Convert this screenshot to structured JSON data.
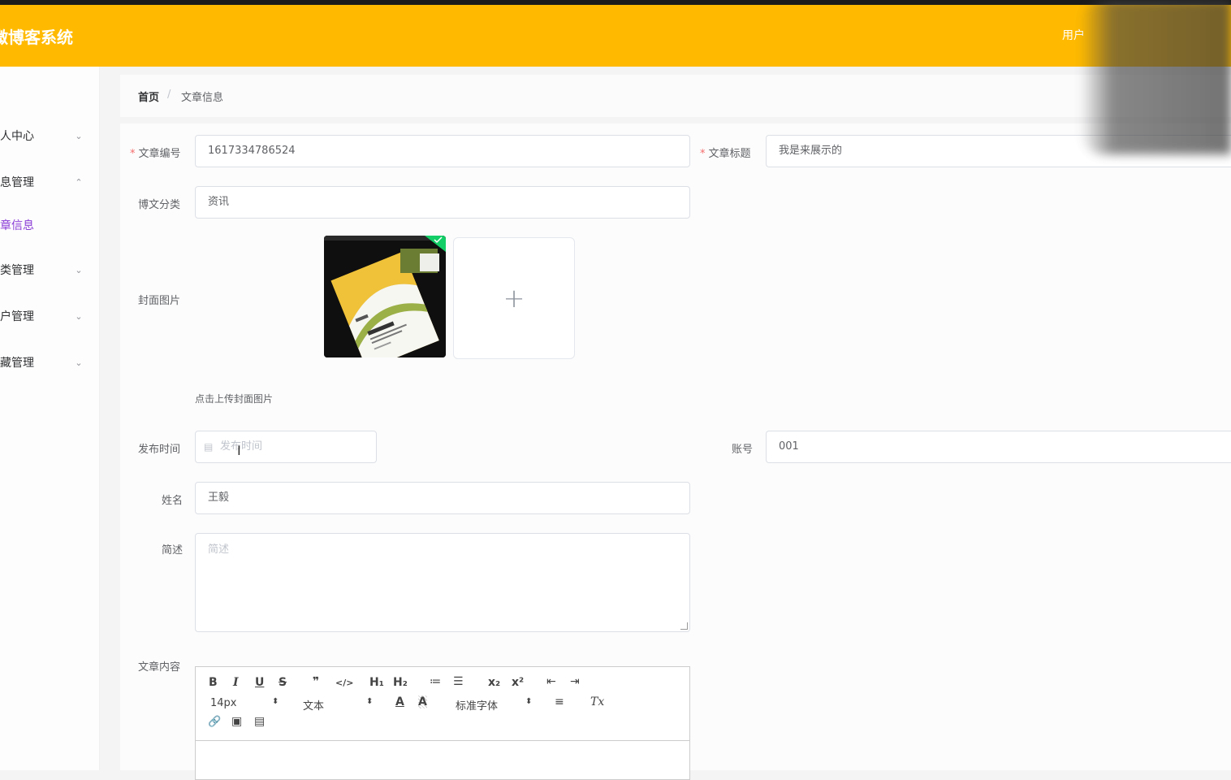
{
  "header": {
    "app_title": "微博客系统",
    "user_label": "用户"
  },
  "sidebar": {
    "items": [
      {
        "label": "个人中心",
        "arrow": "⌄"
      },
      {
        "label": "信息管理",
        "arrow": "⌃"
      },
      {
        "label": "文章信息",
        "arrow": ""
      },
      {
        "label": "分类管理",
        "arrow": "⌄"
      },
      {
        "label": "用户管理",
        "arrow": "⌄"
      },
      {
        "label": "收藏管理",
        "arrow": "⌄"
      }
    ]
  },
  "breadcrumb": {
    "home": "首页",
    "separator": "/",
    "current": "文章信息"
  },
  "form": {
    "article_no": {
      "label": "文章编号",
      "value": "1617334786524"
    },
    "article_title": {
      "label": "文章标题",
      "value": "我是来展示的"
    },
    "category": {
      "label": "博文分类",
      "value": "资讯"
    },
    "cover": {
      "label": "封面图片",
      "hint": "点击上传封面图片",
      "plus": "+"
    },
    "publish_time": {
      "label": "发布时间",
      "placeholder": "发布时间"
    },
    "account": {
      "label": "账号",
      "value": "001"
    },
    "name": {
      "label": "姓名",
      "value": "王毅"
    },
    "summary": {
      "label": "简述",
      "placeholder": "简述"
    },
    "content": {
      "label": "文章内容"
    }
  },
  "editor_toolbar": {
    "bold": "B",
    "italic": "I",
    "underline": "U",
    "strike": "S",
    "blockquote": "❞",
    "code": "</>",
    "h1": "H₁",
    "h2": "H₂",
    "ordered_list": "≔",
    "bullet_list": "☰",
    "subscript": "x₂",
    "superscript": "x²",
    "indent_decrease": "⇤",
    "indent_increase": "⇥",
    "size": "14px",
    "header_picker": "文本",
    "font_color": "A",
    "background_color": "A",
    "font_family": "标准字体",
    "align": "≡",
    "clean": "Tx",
    "link": "🔗",
    "image": "▣",
    "video": "▤",
    "picker_arrow": "⬍"
  },
  "colors": {
    "header": "#ffba00",
    "accent": "#8a3cd6",
    "required": "#f56c6c"
  }
}
